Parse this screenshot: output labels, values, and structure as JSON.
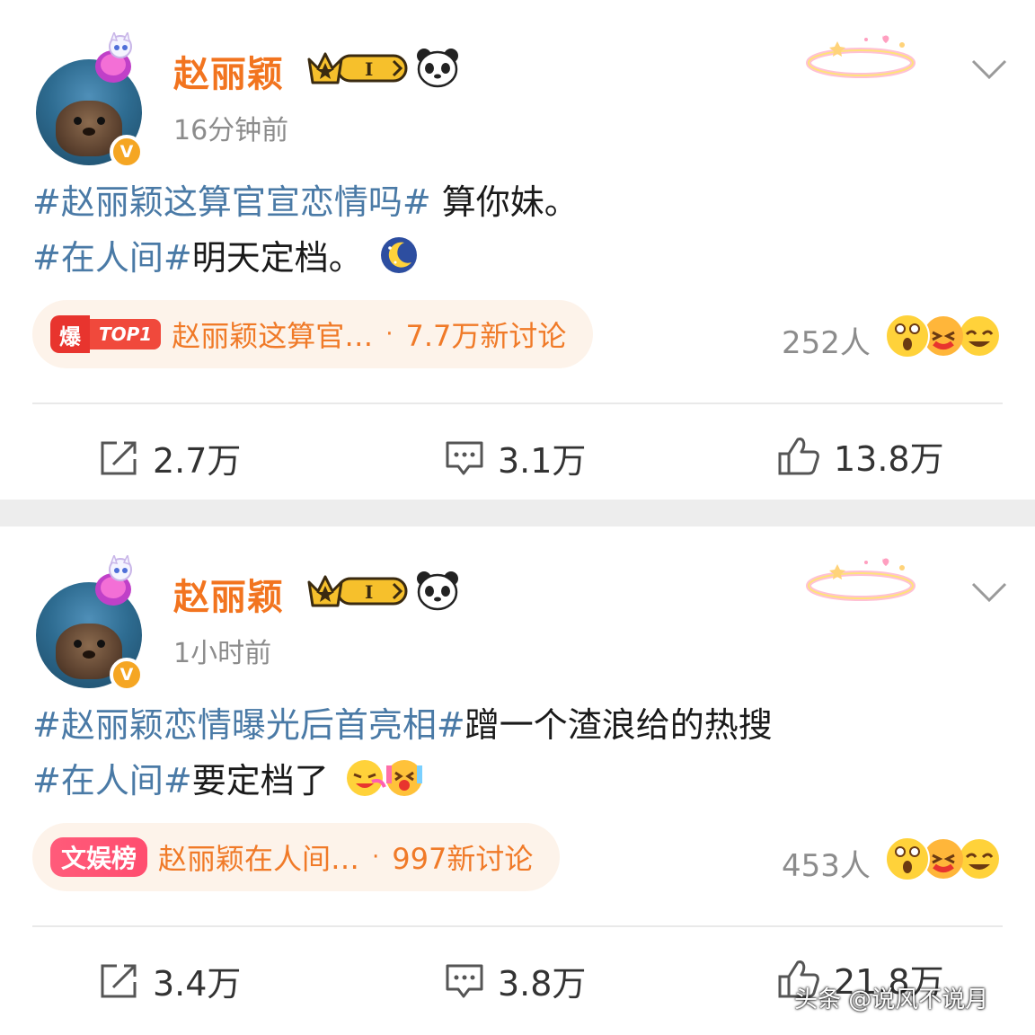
{
  "posts": [
    {
      "username": "赵丽颖",
      "verify_mark": "V",
      "badge_level": "I",
      "timestamp": "16分钟前",
      "line1_tag": "#赵丽颖这算官宣恋情吗#",
      "line1_text": " 算你妹。",
      "line2_tag": "#在人间#",
      "line2_text": "明天定档。",
      "topic_badge": "爆",
      "topic_rank": "TOP1",
      "topic_title": "赵丽颖这算官…",
      "topic_count": "7.7万新讨论",
      "reaction_count": "252人",
      "repost_count": "2.7万",
      "comment_count": "3.1万",
      "like_count": "13.8万"
    },
    {
      "username": "赵丽颖",
      "verify_mark": "V",
      "badge_level": "I",
      "timestamp": "1小时前",
      "line1_tag": "#赵丽颖恋情曝光后首亮相#",
      "line1_text": "蹭一个渣浪给的热搜",
      "line2_tag": "#在人间#",
      "line2_text": "要定档了",
      "topic_badge": "文娱榜",
      "topic_title": "赵丽颖在人间…",
      "topic_count": "997新讨论",
      "reaction_count": "453人",
      "repost_count": "3.4万",
      "comment_count": "3.8万",
      "like_count": "21.8万"
    }
  ],
  "pill_separator": "·",
  "watermark": "头条 @说风不说月",
  "colors": {
    "username": "#f2741f",
    "hashtag": "#4a7aa6",
    "topic_text": "#f07a28",
    "pill_bg": "#fdf3ea",
    "hot_red": "#e8342e",
    "verify_gold": "#f5a623"
  },
  "icons": [
    "crown-level-badge",
    "panda-icon",
    "halo-decoration",
    "chevron-down-icon",
    "repost-icon",
    "comment-icon",
    "like-icon",
    "moon-emoji",
    "laugh-emoji",
    "surprised-emoji"
  ]
}
